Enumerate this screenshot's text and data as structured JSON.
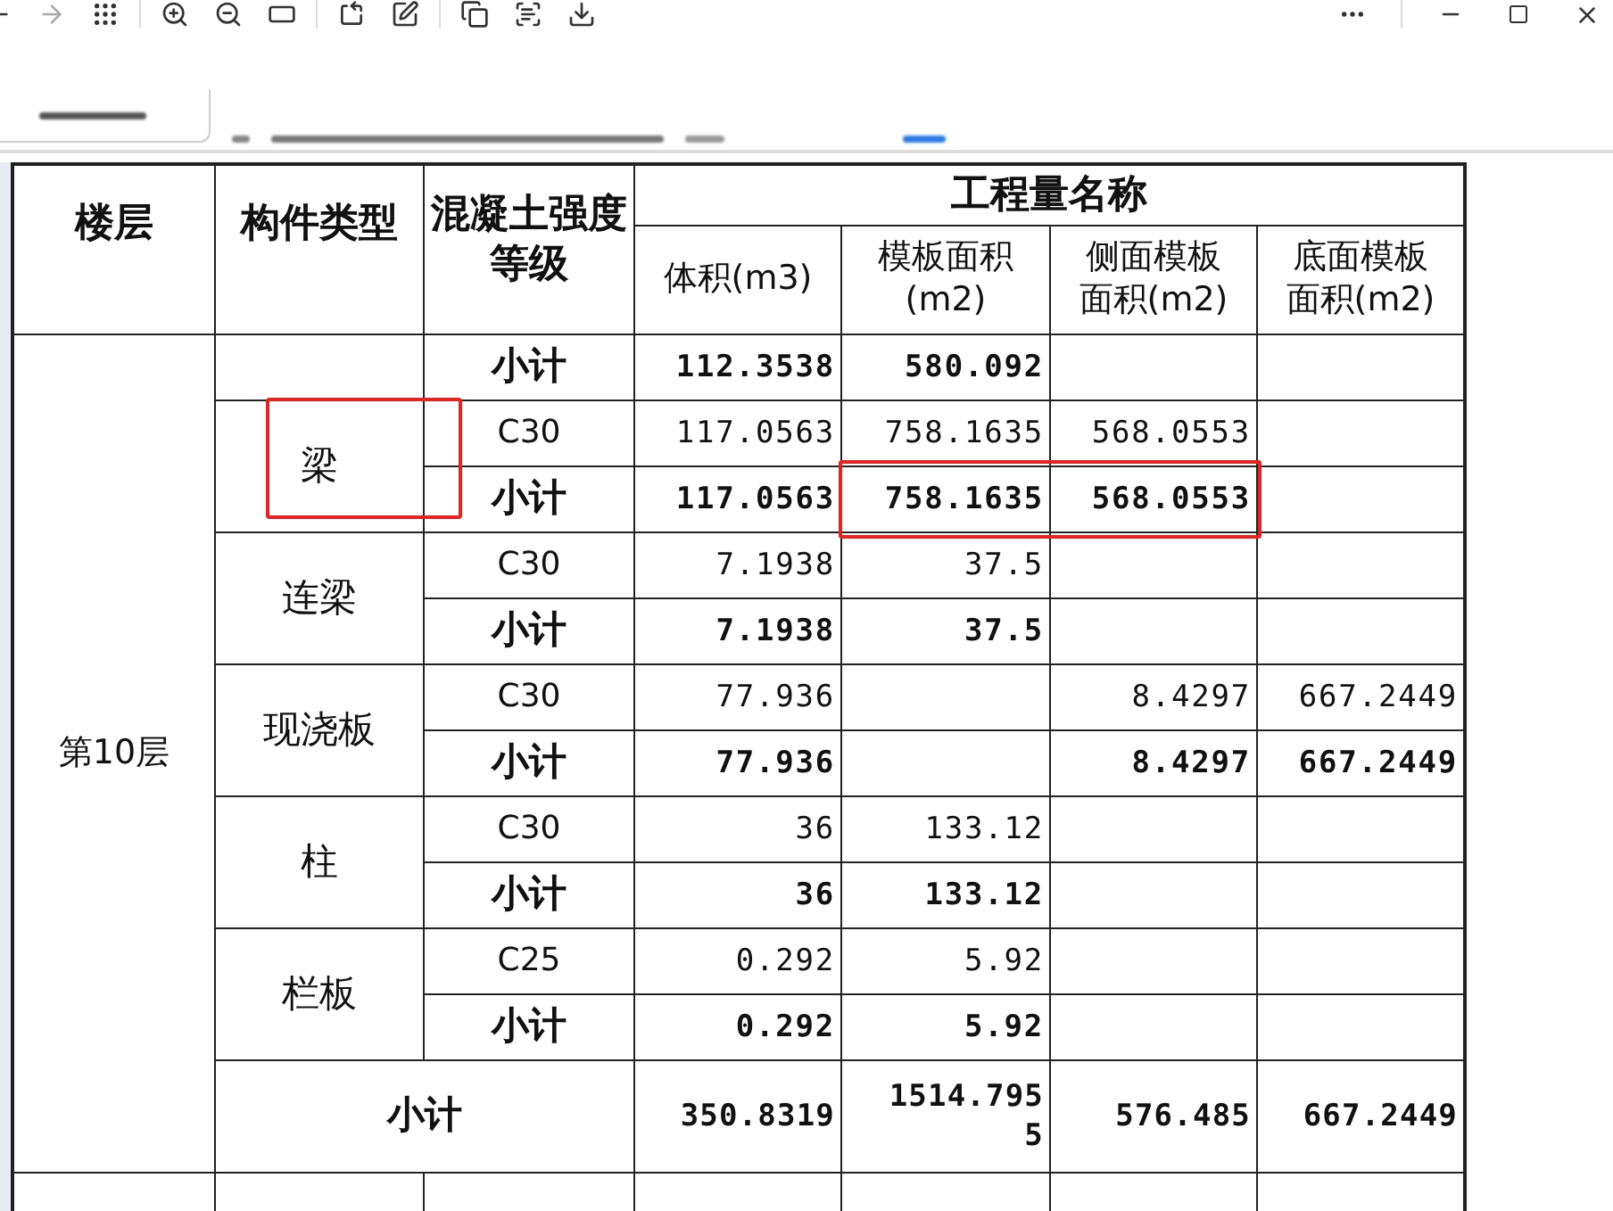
{
  "table": {
    "header": {
      "floor": "楼层",
      "type": "构件类型",
      "grade": "混凝土强度等级",
      "group": "工程量名称",
      "columns": [
        "体积(m3)",
        "模板面积(m2)",
        "侧面模板面积(m2)",
        "底面模板面积(m2)"
      ]
    },
    "floor": "第10层",
    "groups": [
      {
        "highlighted": false,
        "rows": [
          {
            "kind": "subtotal",
            "grade": "小计",
            "volume": "112.3538",
            "formwork": "580.092",
            "highlighted": false
          }
        ]
      },
      {
        "type": "梁",
        "highlighted": true,
        "rows": [
          {
            "kind": "item",
            "grade": "C30",
            "volume": "117.0563",
            "formwork": "758.1635",
            "side_formwork": "568.0553",
            "highlighted": false
          },
          {
            "kind": "subtotal",
            "grade": "小计",
            "volume": "117.0563",
            "formwork": "758.1635",
            "side_formwork": "568.0553",
            "highlighted": true
          }
        ]
      },
      {
        "type": "连梁",
        "highlighted": false,
        "rows": [
          {
            "kind": "item",
            "grade": "C30",
            "volume": "7.1938",
            "formwork": "37.5",
            "highlighted": false
          },
          {
            "kind": "subtotal",
            "grade": "小计",
            "volume": "7.1938",
            "formwork": "37.5",
            "highlighted": false
          }
        ]
      },
      {
        "type": "现浇板",
        "highlighted": false,
        "rows": [
          {
            "kind": "item",
            "grade": "C30",
            "volume": "77.936",
            "side_formwork": "8.4297",
            "bottom_formwork": "667.2449",
            "highlighted": false
          },
          {
            "kind": "subtotal",
            "grade": "小计",
            "volume": "77.936",
            "side_formwork": "8.4297",
            "bottom_formwork": "667.2449",
            "highlighted": false
          }
        ]
      },
      {
        "type": "柱",
        "highlighted": false,
        "rows": [
          {
            "kind": "item",
            "grade": "C30",
            "volume": "36",
            "formwork": "133.12",
            "highlighted": false
          },
          {
            "kind": "subtotal",
            "grade": "小计",
            "volume": "36",
            "formwork": "133.12",
            "highlighted": false
          }
        ]
      },
      {
        "type": "栏板",
        "highlighted": false,
        "rows": [
          {
            "kind": "item",
            "grade": "C25",
            "volume": "0.292",
            "formwork": "5.92",
            "highlighted": false
          },
          {
            "kind": "subtotal",
            "grade": "小计",
            "volume": "0.292",
            "formwork": "5.92",
            "highlighted": false
          }
        ]
      }
    ],
    "total": {
      "label": "小计",
      "volume": "350.8319",
      "formwork": "1514.7955",
      "side_formwork": "576.485",
      "bottom_formwork": "667.2449"
    }
  }
}
